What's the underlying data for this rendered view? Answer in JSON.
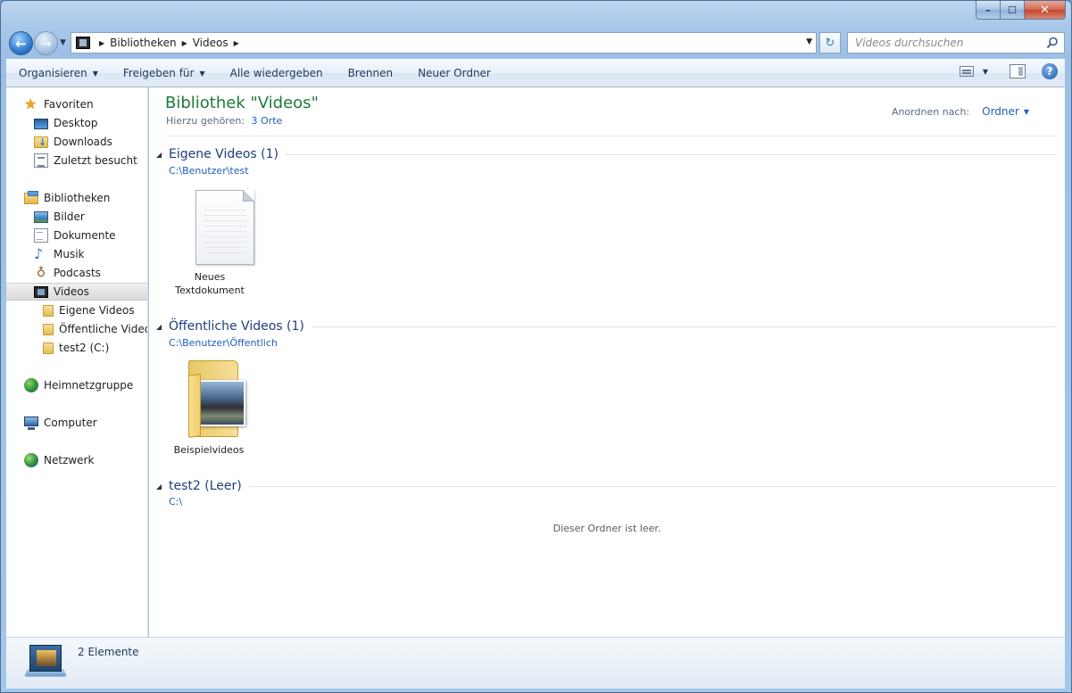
{
  "window": {
    "caption": {
      "min": "–",
      "max": "☐",
      "close": "✕"
    }
  },
  "nav": {
    "back_glyph": "←",
    "fwd_glyph": "→",
    "breadcrumb": [
      "Bibliotheken",
      "Videos"
    ],
    "refresh_glyph": "↻",
    "search_placeholder": "Videos durchsuchen"
  },
  "toolbar": {
    "organize": "Organisieren",
    "share": "Freigeben für",
    "play_all": "Alle wiedergeben",
    "burn": "Brennen",
    "new_folder": "Neuer Ordner",
    "help_glyph": "?"
  },
  "sidebar": {
    "favorites": {
      "label": "Favoriten",
      "icon": "star-icon"
    },
    "favorites_items": [
      {
        "label": "Desktop",
        "icon": "desktop-icon"
      },
      {
        "label": "Downloads",
        "icon": "downloads-folder-icon"
      },
      {
        "label": "Zuletzt besucht",
        "icon": "recent-places-icon"
      }
    ],
    "libraries": {
      "label": "Bibliotheken",
      "icon": "library-icon"
    },
    "libraries_items": [
      {
        "label": "Bilder",
        "icon": "pictures-icon"
      },
      {
        "label": "Dokumente",
        "icon": "documents-icon"
      },
      {
        "label": "Musik",
        "icon": "music-icon"
      },
      {
        "label": "Podcasts",
        "icon": "podcast-icon"
      },
      {
        "label": "Videos",
        "icon": "videos-icon",
        "selected": true
      }
    ],
    "videos_children": [
      {
        "label": "Eigene Videos",
        "icon": "folder-icon"
      },
      {
        "label": "Öffentliche Videos",
        "icon": "folder-icon"
      },
      {
        "label": "test2 (C:)",
        "icon": "folder-icon"
      }
    ],
    "homegroup": {
      "label": "Heimnetzgruppe",
      "icon": "homegroup-icon"
    },
    "computer": {
      "label": "Computer",
      "icon": "computer-icon"
    },
    "network": {
      "label": "Netzwerk",
      "icon": "network-icon"
    }
  },
  "content": {
    "title": "Bibliothek \"Videos\"",
    "includes_label": "Hierzu gehören:",
    "includes_link": "3 Orte",
    "arrange_label": "Anordnen nach:",
    "arrange_value": "Ordner",
    "groups": [
      {
        "title": "Eigene Videos (1)",
        "path": "C:\\Benutzer\\test",
        "items": [
          {
            "name_line1": "Neues",
            "name_line2": "Textdokument",
            "icon": "text-document-icon"
          }
        ]
      },
      {
        "title": "Öffentliche Videos (1)",
        "path": "C:\\Benutzer\\Öffentlich",
        "items": [
          {
            "name": "Beispielvideos",
            "icon": "folder-with-video-icon"
          }
        ]
      },
      {
        "title": "test2 (Leer)",
        "path": "C:\\",
        "empty_message": "Dieser Ordner ist leer."
      }
    ]
  },
  "status": {
    "count": "2 Elemente",
    "icon": "videos-library-icon"
  }
}
